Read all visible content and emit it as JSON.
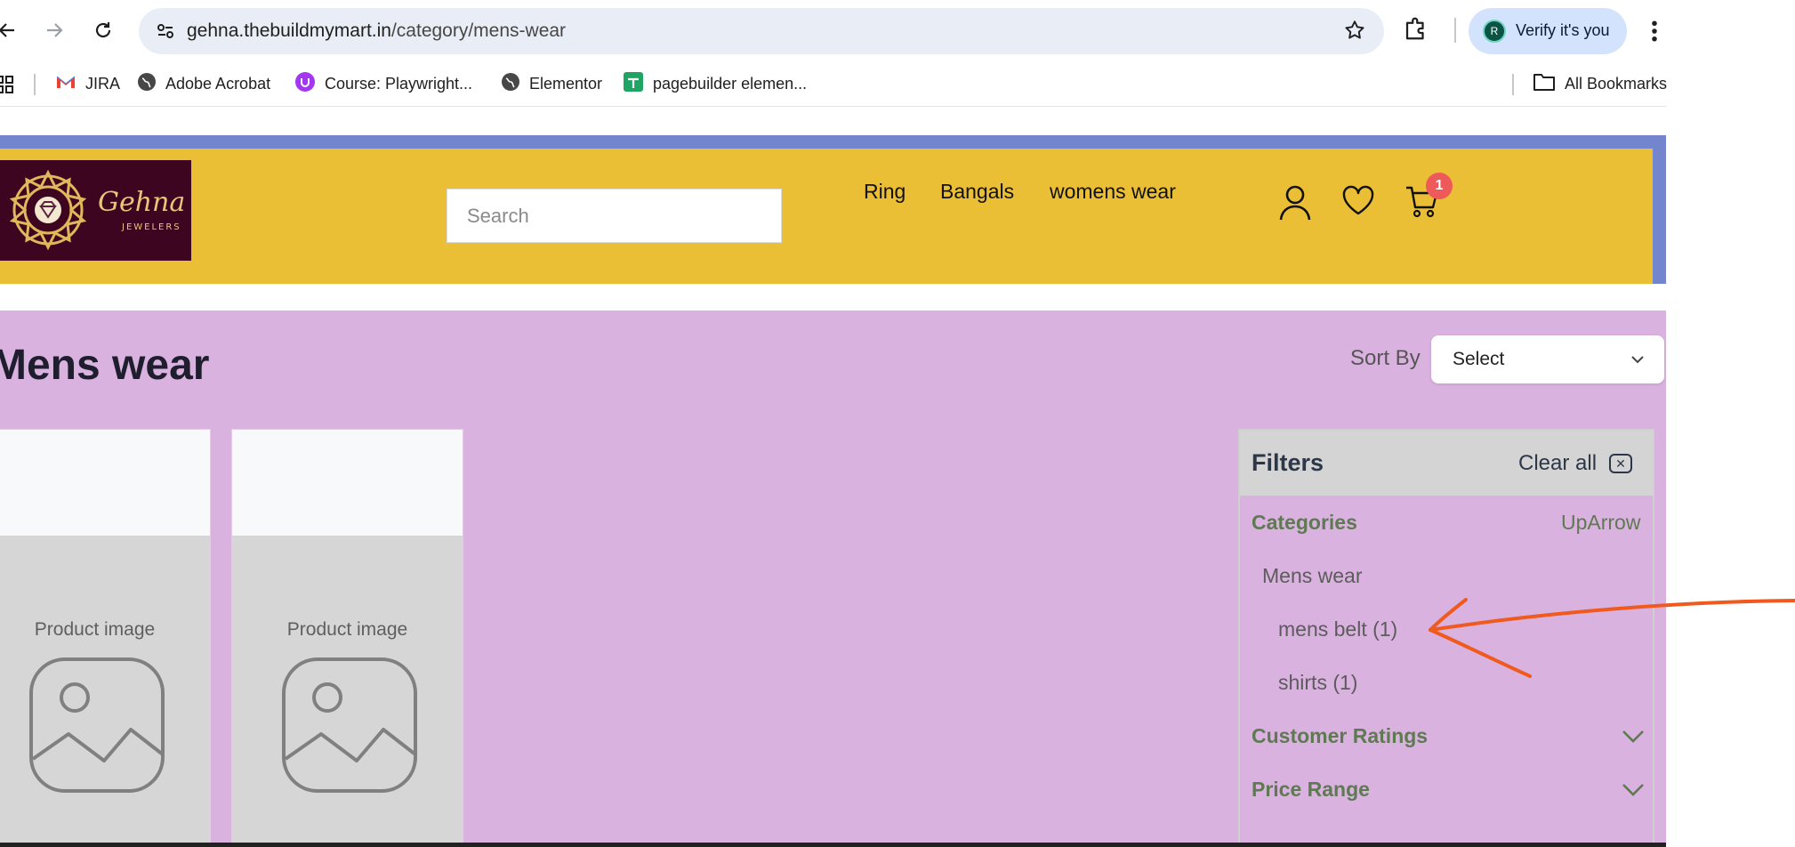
{
  "browser": {
    "url_host": "gehna.thebuildmymart.in",
    "url_path": "/category/mens-wear",
    "profile_initial": "R",
    "profile_label": "Verify it's you"
  },
  "bookmarks": [
    {
      "label": "JIRA",
      "icon": "gmail-icon"
    },
    {
      "label": "Adobe Acrobat",
      "icon": "globe-icon"
    },
    {
      "label": "Course: Playwright...",
      "icon": "course-icon"
    },
    {
      "label": "Elementor",
      "icon": "globe-icon"
    },
    {
      "label": "pagebuilder elemen...",
      "icon": "sheets-icon"
    }
  ],
  "all_bookmarks_label": "All Bookmarks",
  "site": {
    "logo_text": "Gehna",
    "logo_sub": "JEWELERS",
    "search_placeholder": "Search",
    "nav": [
      "Ring",
      "Bangals",
      "womens wear"
    ],
    "cart_count": "1"
  },
  "category": {
    "title": "Mens wear",
    "sort_label": "Sort By",
    "sort_value": "Select"
  },
  "products": [
    {
      "image_label": "Product image"
    },
    {
      "image_label": "Product image"
    }
  ],
  "filters": {
    "title": "Filters",
    "clear_all": "Clear all",
    "categories_label": "Categories",
    "categories_toggle": "UpArrow",
    "parent_category": "Mens wear",
    "subcategories": [
      "mens belt (1)",
      "shirts (1)"
    ],
    "customer_ratings_label": "Customer Ratings",
    "price_range_label": "Price Range"
  },
  "colors": {
    "header": "#eabe35",
    "stripe": "#7285cd",
    "content_bg": "#dab2e0",
    "annotation_arrow": "#f05a1e"
  }
}
